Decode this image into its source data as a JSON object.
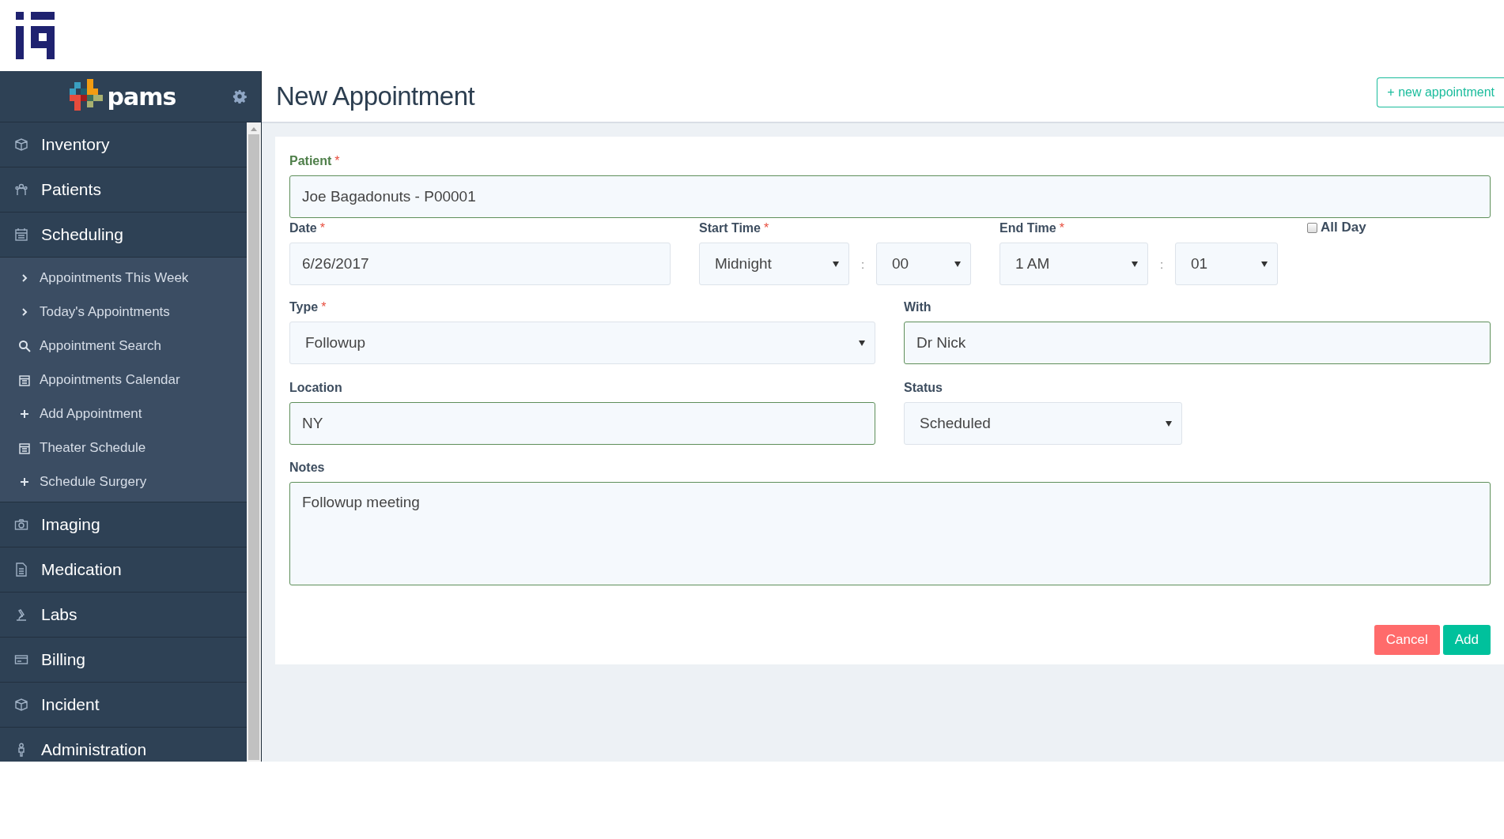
{
  "brand": {
    "name": "pams"
  },
  "sidebar": {
    "items": [
      {
        "label": "Inventory"
      },
      {
        "label": "Patients"
      },
      {
        "label": "Scheduling",
        "children": [
          {
            "label": "Appointments This Week"
          },
          {
            "label": "Today's Appointments"
          },
          {
            "label": "Appointment Search"
          },
          {
            "label": "Appointments Calendar"
          },
          {
            "label": "Add Appointment"
          },
          {
            "label": "Theater Schedule"
          },
          {
            "label": "Schedule Surgery"
          }
        ]
      },
      {
        "label": "Imaging"
      },
      {
        "label": "Medication"
      },
      {
        "label": "Labs"
      },
      {
        "label": "Billing"
      },
      {
        "label": "Incident"
      },
      {
        "label": "Administration"
      }
    ]
  },
  "header": {
    "title": "New Appointment",
    "action": "+ new appointment"
  },
  "form": {
    "patient": {
      "label": "Patient",
      "marker": "*",
      "value": "Joe Bagadonuts - P00001",
      "valid": true,
      "focused": true
    },
    "date": {
      "label": "Date",
      "marker": "*",
      "value": "6/26/2017",
      "valid": false
    },
    "start_time": {
      "label": "Start Time",
      "marker": "*",
      "hour": "Midnight",
      "separator": ":",
      "minute": "00"
    },
    "end_time": {
      "label": "End Time",
      "marker": "*",
      "hour": "1 AM",
      "separator": ":",
      "minute": "01"
    },
    "all_day": {
      "label": "All Day",
      "checked": false
    },
    "type": {
      "label": "Type",
      "marker": "*",
      "value": "Followup"
    },
    "with": {
      "label": "With",
      "value": "Dr Nick",
      "valid": true
    },
    "location": {
      "label": "Location",
      "value": "NY",
      "valid": true
    },
    "status": {
      "label": "Status",
      "value": "Scheduled"
    },
    "notes": {
      "label": "Notes",
      "value": "Followup meeting",
      "valid": true
    }
  },
  "buttons": [
    {
      "label": "Cancel",
      "kind": "cancel"
    },
    {
      "label": "Add",
      "kind": "primary"
    }
  ]
}
